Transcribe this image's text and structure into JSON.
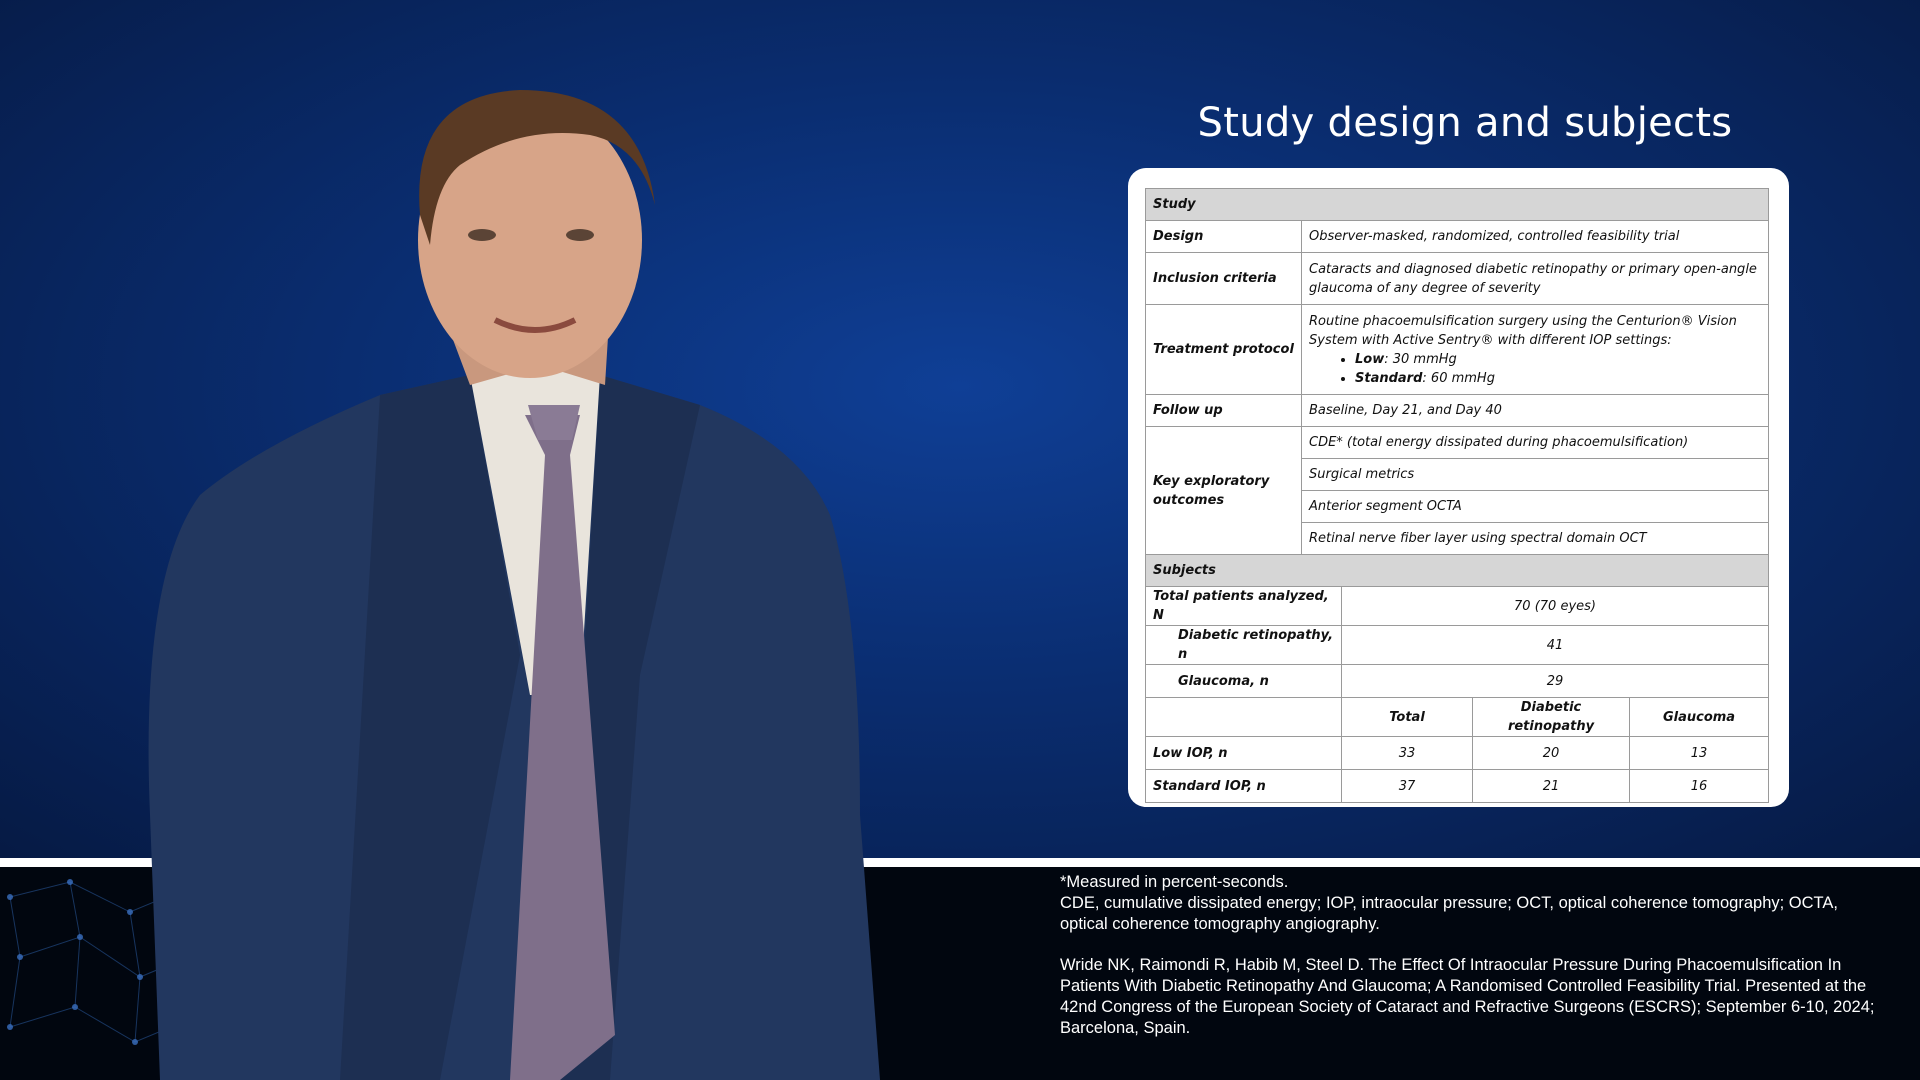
{
  "slide": {
    "title": "Study design and subjects"
  },
  "table": {
    "study_header": "Study",
    "design_label": "Design",
    "design_value": "Observer-masked, randomized, controlled feasibility trial",
    "inclusion_label": "Inclusion criteria",
    "inclusion_value": "Cataracts and diagnosed diabetic retinopathy or primary open-angle glaucoma of any degree of severity",
    "treatment_label": "Treatment protocol",
    "treatment_intro": "Routine phacoemulsification surgery using the Centurion® Vision System with Active Sentry® with different IOP settings:",
    "treatment_low_label": "Low",
    "treatment_low_value": ": 30 mmHg",
    "treatment_std_label": "Standard",
    "treatment_std_value": ": 60 mmHg",
    "followup_label": "Follow up",
    "followup_value": "Baseline, Day 21, and Day 40",
    "outcomes_label": "Key exploratory outcomes",
    "outcomes": [
      "CDE* (total energy dissipated during phacoemulsification)",
      "Surgical metrics",
      "Anterior segment OCTA",
      "Retinal nerve fiber layer using spectral domain OCT"
    ],
    "subjects_header": "Subjects",
    "total_label": "Total patients analyzed, N",
    "total_value": "70 (70 eyes)",
    "dr_label": "Diabetic retinopathy, n",
    "dr_value": "41",
    "gl_label": "Glaucoma, n",
    "gl_value": "29",
    "col_total": "Total",
    "col_dr": "Diabetic retinopathy",
    "col_gl": "Glaucoma",
    "low_iop_label": "Low IOP, n",
    "low_iop": [
      "33",
      "20",
      "13"
    ],
    "std_iop_label": "Standard IOP, n",
    "std_iop": [
      "37",
      "21",
      "16"
    ]
  },
  "footnotes": {
    "measured": "*Measured in percent-seconds.",
    "abbreviations": "CDE, cumulative dissipated energy; IOP, intraocular pressure; OCT, optical coherence tomography; OCTA, optical coherence tomography angiography.",
    "reference": "Wride NK, Raimondi R, Habib M, Steel D. The Effect Of Intraocular Pressure During Phacoemulsification In Patients With Diabetic Retinopathy And Glaucoma; A Randomised Controlled Feasibility Trial. Presented at the 42nd Congress of the European Society of Cataract and Refractive Surgeons (ESCRS); September 6-10, 2024; Barcelona, Spain."
  },
  "colors": {
    "background_blue": "#0a2d70",
    "footer_black": "#01060f",
    "table_header_gray": "#d6d6d6"
  }
}
